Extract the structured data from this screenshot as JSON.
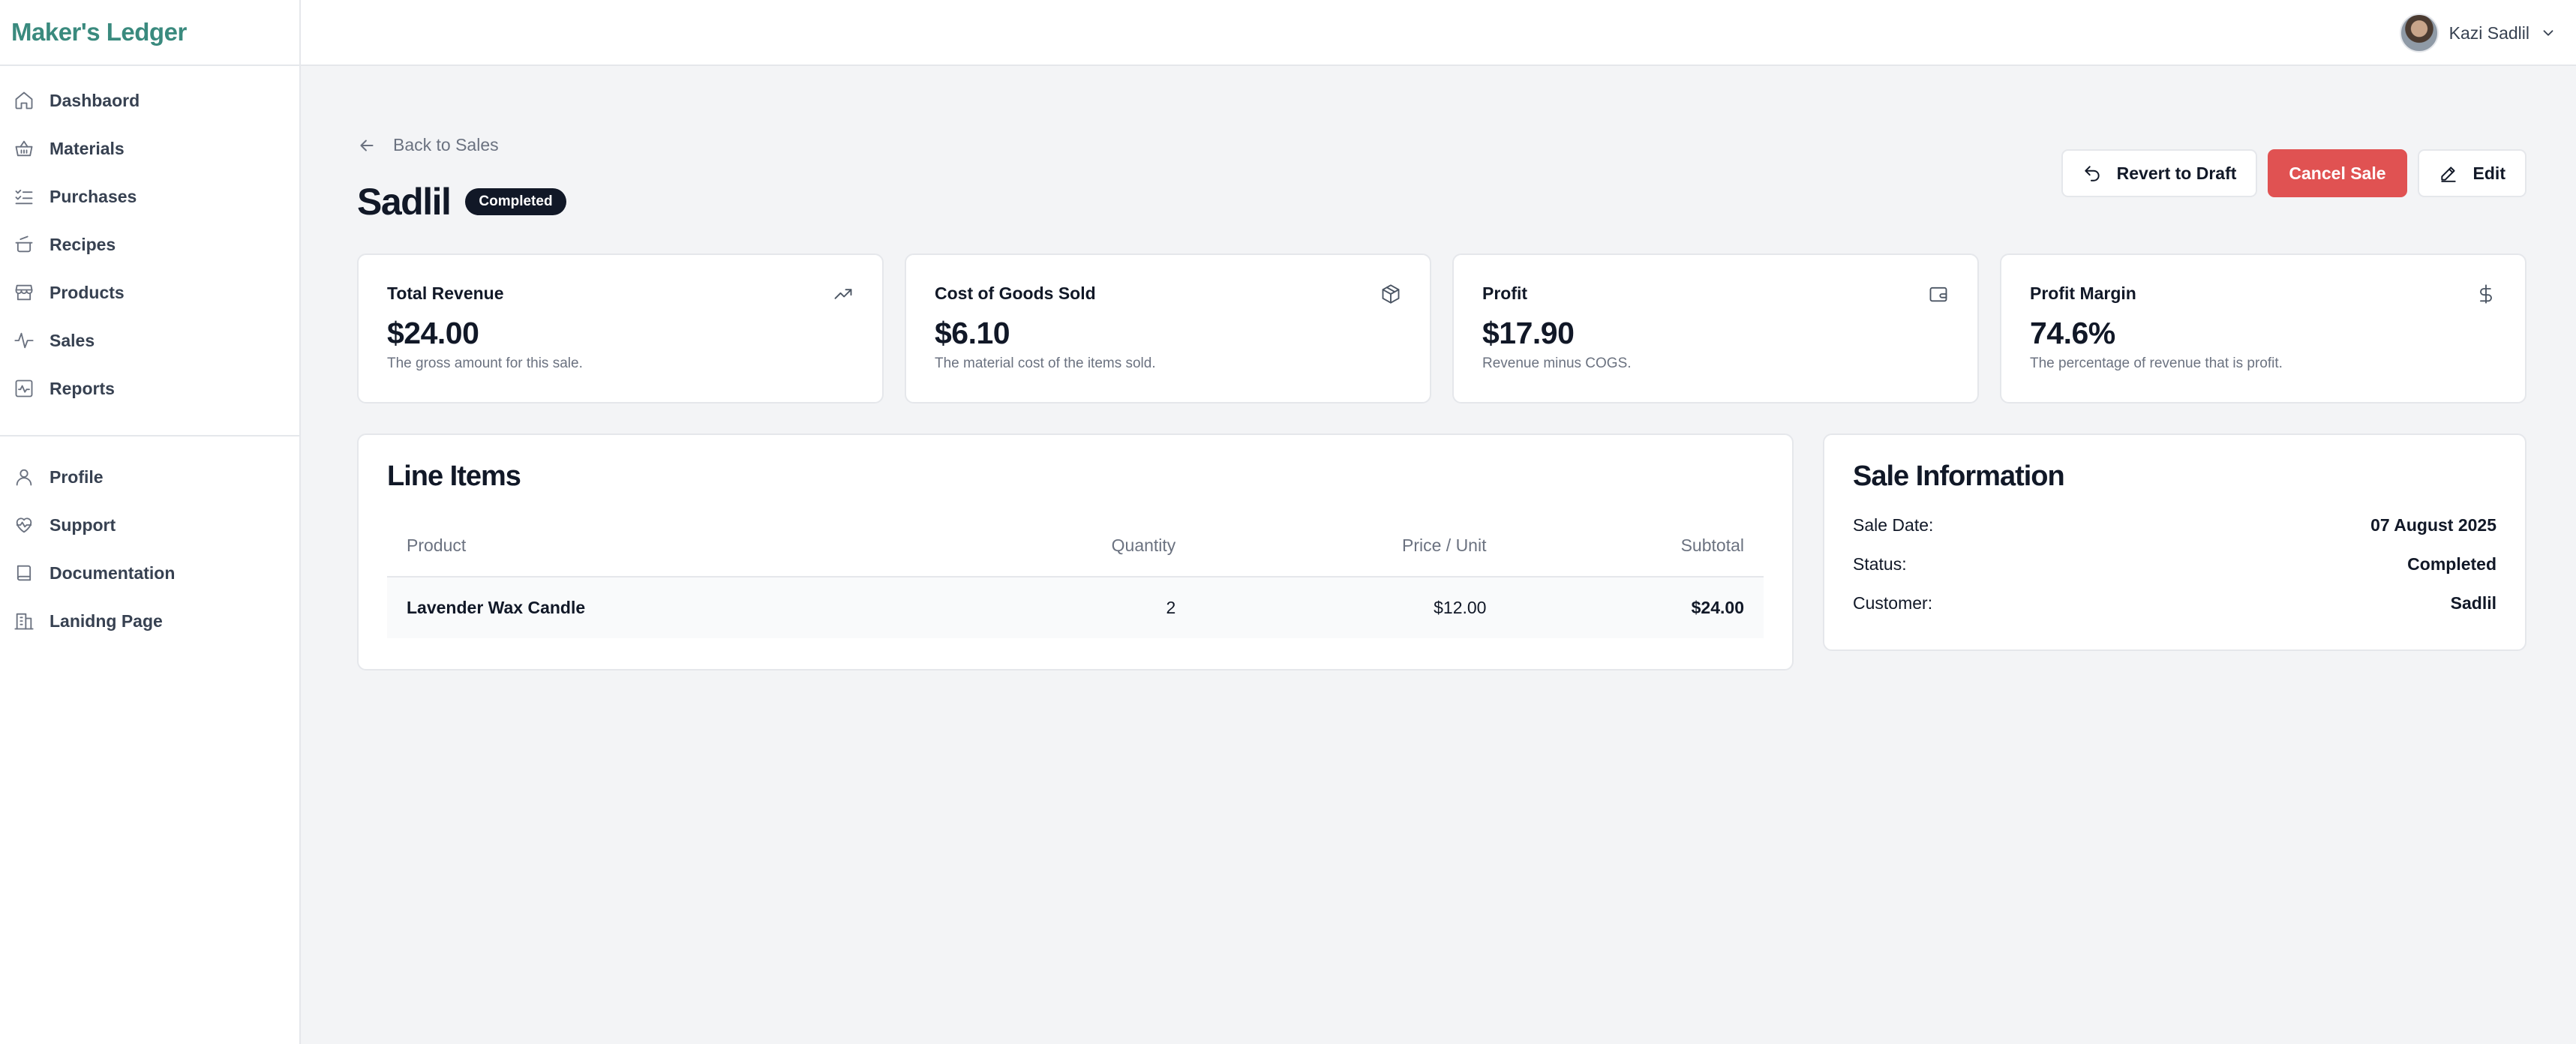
{
  "app": {
    "brand": "Maker's Ledger"
  },
  "sidebar": {
    "main_items": [
      {
        "label": "Dashbaord",
        "icon": "home-icon"
      },
      {
        "label": "Materials",
        "icon": "basket-icon"
      },
      {
        "label": "Purchases",
        "icon": "list-checks-icon"
      },
      {
        "label": "Recipes",
        "icon": "cooking-pot-icon"
      },
      {
        "label": "Products",
        "icon": "store-icon"
      },
      {
        "label": "Sales",
        "icon": "activity-icon"
      },
      {
        "label": "Reports",
        "icon": "chart-square-icon"
      }
    ],
    "secondary_items": [
      {
        "label": "Profile",
        "icon": "user-icon"
      },
      {
        "label": "Support",
        "icon": "heart-pulse-icon"
      },
      {
        "label": "Documentation",
        "icon": "book-icon"
      },
      {
        "label": "Lanidng Page",
        "icon": "building-icon"
      }
    ]
  },
  "topbar": {
    "user_name": "Kazi Sadlil"
  },
  "page": {
    "back_label": "Back to Sales",
    "title": "Sadlil",
    "status_badge": "Completed",
    "actions": {
      "revert": "Revert to Draft",
      "cancel": "Cancel Sale",
      "edit": "Edit"
    }
  },
  "stats": [
    {
      "title": "Total Revenue",
      "value": "$24.00",
      "desc": "The gross amount for this sale.",
      "icon": "trending-up-icon"
    },
    {
      "title": "Cost of Goods Sold",
      "value": "$6.10",
      "desc": "The material cost of the items sold.",
      "icon": "package-icon"
    },
    {
      "title": "Profit",
      "value": "$17.90",
      "desc": "Revenue minus COGS.",
      "icon": "wallet-icon"
    },
    {
      "title": "Profit Margin",
      "value": "74.6%",
      "desc": "The percentage of revenue that is profit.",
      "icon": "dollar-icon"
    }
  ],
  "line_items": {
    "title": "Line Items",
    "columns": [
      "Product",
      "Quantity",
      "Price / Unit",
      "Subtotal"
    ],
    "rows": [
      {
        "product": "Lavender Wax Candle",
        "quantity": "2",
        "price": "$12.00",
        "subtotal": "$24.00"
      }
    ]
  },
  "sale_info": {
    "title": "Sale Information",
    "fields": [
      {
        "label": "Sale Date:",
        "value": "07 August 2025"
      },
      {
        "label": "Status:",
        "value": "Completed"
      },
      {
        "label": "Customer:",
        "value": "Sadlil"
      }
    ]
  }
}
